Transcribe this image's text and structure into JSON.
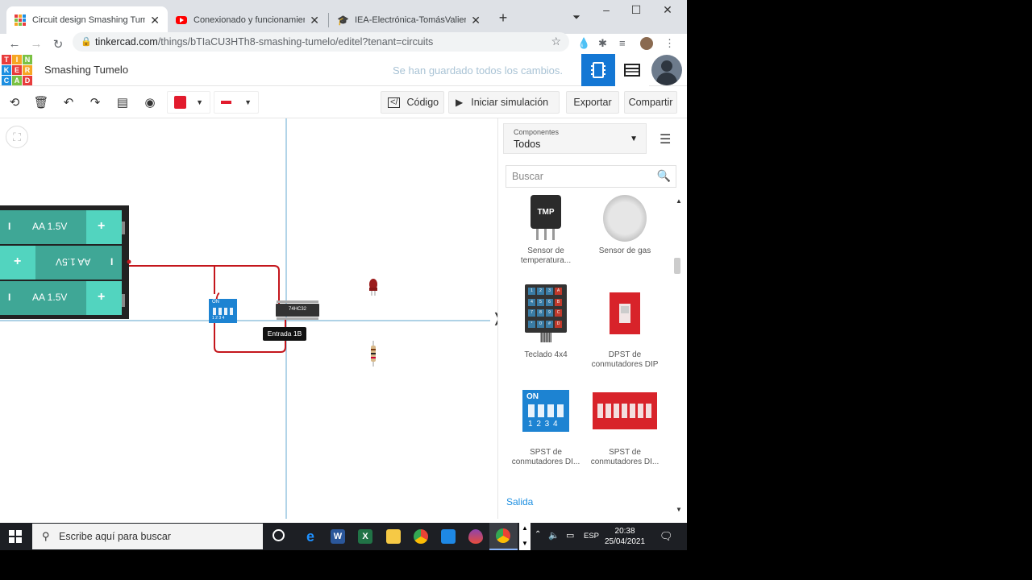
{
  "browser": {
    "tabs": [
      {
        "title": "Circuit design Smashing Tumelo",
        "active": true
      },
      {
        "title": "Conexionado y funcionamiento d",
        "active": false
      },
      {
        "title": "IEA-Electrónica-TomásValiente: 1",
        "active": false
      }
    ],
    "url_host": "tinkercad.com",
    "url_path": "/things/bTIaCU3HTh8-smashing-tumelo/editel?tenant=circuits"
  },
  "header": {
    "logo_letters": [
      "T",
      "I",
      "N",
      "K",
      "E",
      "R",
      "C",
      "A",
      "D"
    ],
    "design_name": "Smashing Tumelo",
    "save_status": "Se han guardado todos los cambios."
  },
  "toolbar": {
    "code_label": "Código",
    "simulate_label": "Iniciar simulación",
    "export_label": "Exportar",
    "share_label": "Compartir",
    "fill_color": "#e21b2d",
    "wire_color": "#e21b2d"
  },
  "canvas": {
    "battery_labels": [
      "AA 1.5V",
      "AA 1.5V",
      "AA 1.5V"
    ],
    "battery_minus": "I",
    "battery_plus": "+",
    "dip_label": "ON",
    "dip_numbers": "1 2 3 4",
    "chip_label": "74HC32",
    "tooltip": "Entrada 1B",
    "expand_glyph": "❭"
  },
  "panel": {
    "components_label": "Componentes",
    "components_value": "Todos",
    "search_placeholder": "Buscar",
    "items": [
      {
        "name": "Sensor de\ntemperatura..."
      },
      {
        "name": "Sensor de gas"
      },
      {
        "name": "Teclado 4x4"
      },
      {
        "name": "DPST de\nconmutadores DIP"
      },
      {
        "name": "SPST de\nconmutadores DI..."
      },
      {
        "name": "SPST de\nconmutadores DI..."
      }
    ],
    "tmp_label": "TMP",
    "spst_on": "ON",
    "spst_numbers": "1 2 3 4",
    "keypad_keys": [
      "1",
      "2",
      "3",
      "A",
      "4",
      "5",
      "6",
      "B",
      "7",
      "8",
      "9",
      "C",
      "*",
      "0",
      "#",
      "D"
    ],
    "section_label": "Salida"
  },
  "taskbar": {
    "search_placeholder": "Escribe aquí para buscar",
    "lang": "ESP",
    "time": "20:38",
    "date": "25/04/2021"
  }
}
